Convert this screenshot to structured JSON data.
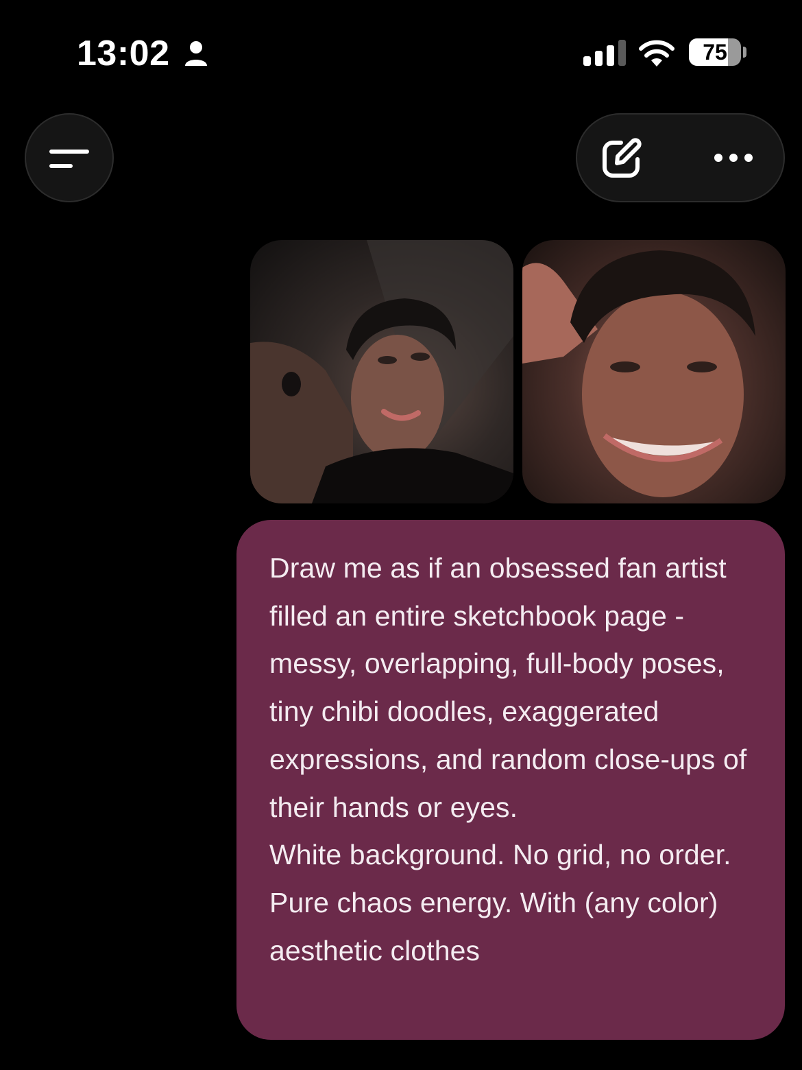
{
  "status_bar": {
    "time": "13:02",
    "person_icon": "person-icon",
    "signal_icon": "cellular-signal-icon",
    "wifi_icon": "wifi-icon",
    "battery_level": "75",
    "battery_fraction": 0.75
  },
  "header": {
    "menu_icon": "menu-lines-icon",
    "edit_icon": "compose-edit-icon",
    "more_icon": "more-dots-icon"
  },
  "attachments": [
    {
      "kind": "photo",
      "subject": "selfie-reclining"
    },
    {
      "kind": "photo",
      "subject": "selfie-smiling"
    }
  ],
  "message": {
    "paragraphs": [
      "Draw me as if an obsessed fan artist filled an entire sketchbook page - messy, overlapping, full-body poses, tiny chibi doodles, exaggerated expressions, and random close-ups of their hands or eyes.",
      "White background. No grid, no order. Pure chaos energy. With (any color) aesthetic clothes"
    ]
  },
  "colors": {
    "background": "#000000",
    "bubble": "#6b2a4a",
    "control_surface": "#151515"
  }
}
